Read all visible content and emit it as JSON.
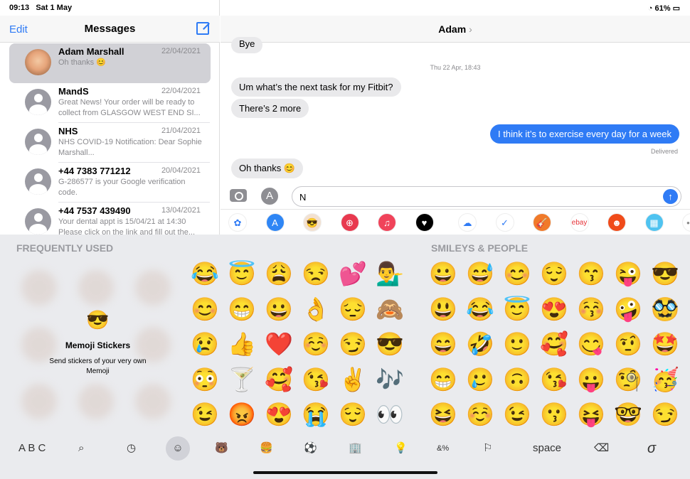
{
  "status": {
    "time": "09:13",
    "date": "Sat 1 May",
    "battery": "61%"
  },
  "sidebar": {
    "edit": "Edit",
    "title": "Messages",
    "conversations": [
      {
        "name": "Adam Marshall",
        "date": "22/04/2021",
        "preview": "Oh thanks 😊",
        "selected": true
      },
      {
        "name": "MandS",
        "date": "22/04/2021",
        "preview": "Great News! Your order will be ready to collect from GLASGOW WEST END SI..."
      },
      {
        "name": "NHS",
        "date": "21/04/2021",
        "preview": "NHS COVID-19 Notification: Dear Sophie Marshall..."
      },
      {
        "name": "+44 7383 771212",
        "date": "20/04/2021",
        "preview": "G-286577 is your Google verification code."
      },
      {
        "name": "+44 7537 439490",
        "date": "13/04/2021",
        "preview": "Your dental appt is 15/04/21 at 14:30 Please click on the link and fill out the..."
      }
    ]
  },
  "chat": {
    "contact": "Adam",
    "chevron": "›",
    "timestamp": "Thu 22 Apr, 18:43",
    "delivered": "Delivered",
    "messages": [
      {
        "text": "Bye",
        "from": "them"
      },
      {
        "text": "Um what’s the next task for my Fitbit?",
        "from": "them"
      },
      {
        "text": "There’s 2 more",
        "from": "them"
      },
      {
        "text": "I think it’s to exercise every day for a week",
        "from": "me"
      },
      {
        "text": "Oh thanks 😊",
        "from": "them"
      }
    ],
    "input_value": "N",
    "apps": [
      "photos",
      "app-store",
      "memoji",
      "search-web",
      "music",
      "heart-app",
      "onedrive",
      "spark-mail",
      "garageband",
      "ebay",
      "reddit",
      "calendar-app",
      "more"
    ],
    "ebay": "ebay",
    "more": "•••"
  },
  "keyboard": {
    "frequently_used": "FREQUENTLY USED",
    "smileys": "SMILEYS & PEOPLE",
    "memoji": {
      "title": "Memoji Stickers",
      "subtitle": "Send stickers of your very own Memoji"
    },
    "frequent": [
      [
        "😂",
        "😇",
        "😩",
        "😒",
        "💕",
        "💁‍♂️"
      ],
      [
        "😊",
        "😁",
        "😀",
        "👌",
        "😔",
        "🙈"
      ],
      [
        "😢",
        "👍",
        "❤️",
        "☺️",
        "😏",
        "😎"
      ],
      [
        "😳",
        "🍸",
        "🥰",
        "😘",
        "✌️",
        "🎶"
      ],
      [
        "😉",
        "😡",
        "😍",
        "😭",
        "😌",
        "👀"
      ]
    ],
    "smileys_grid": [
      [
        "😀",
        "😅",
        "😊",
        "😌",
        "😙",
        "😜",
        "😎"
      ],
      [
        "😃",
        "😂",
        "😇",
        "😍",
        "😚",
        "🤪",
        "🥸"
      ],
      [
        "😄",
        "🤣",
        "🙂",
        "🥰",
        "😋",
        "🤨",
        "🤩"
      ],
      [
        "😁",
        "🥲",
        "🙃",
        "😘",
        "😛",
        "🧐",
        "🥳"
      ],
      [
        "😆",
        "☺️",
        "😉",
        "😗",
        "😝",
        "🤓",
        "😏"
      ]
    ],
    "bar": {
      "abc": "A B C",
      "space": "space"
    }
  }
}
